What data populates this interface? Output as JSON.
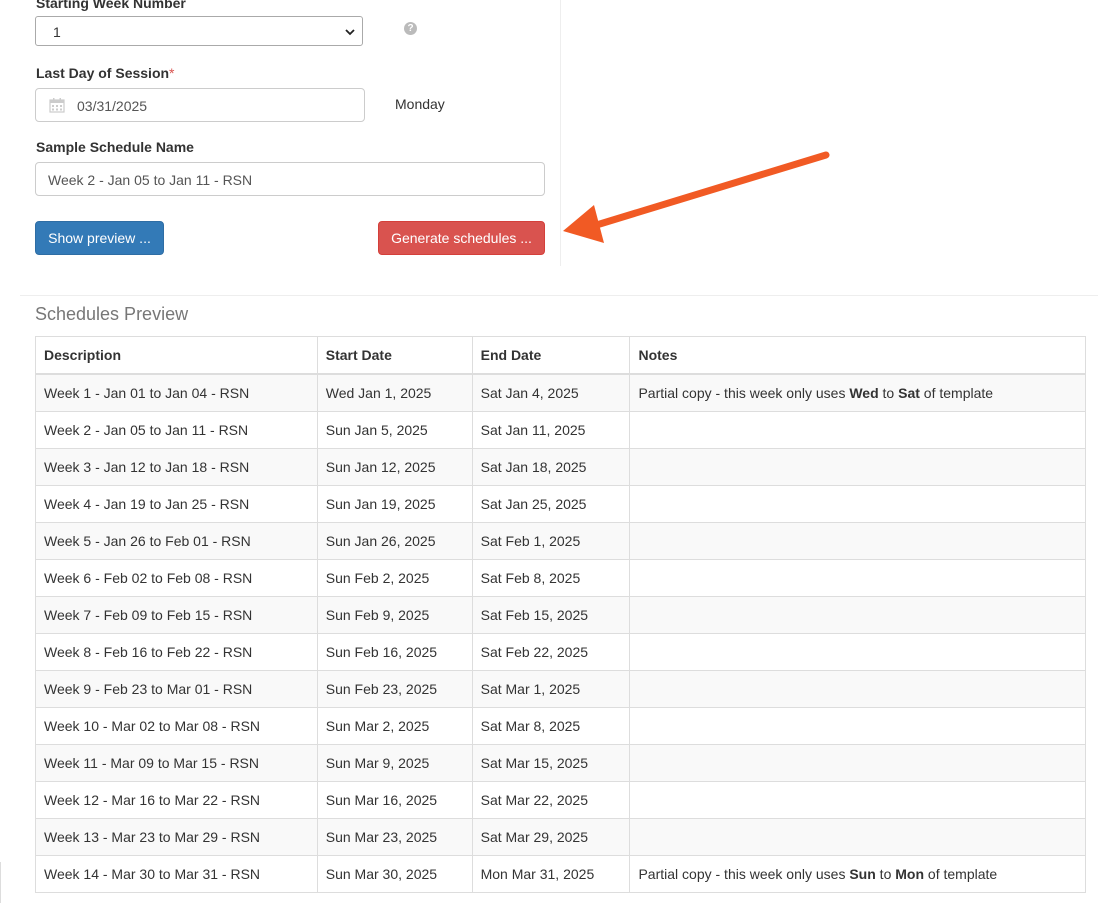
{
  "form": {
    "starting_week_label": "Starting Week Number",
    "starting_week_value": "1",
    "last_day_label": "Last Day of Session",
    "required_marker": "*",
    "last_day_value": "03/31/2025",
    "last_day_weekday": "Monday",
    "sample_name_label": "Sample Schedule Name",
    "sample_name_value": "Week 2 - Jan 05 to Jan 11 - RSN",
    "show_preview_label": "Show preview ...",
    "generate_label": "Generate schedules ..."
  },
  "preview": {
    "title": "Schedules Preview",
    "columns": [
      "Description",
      "Start Date",
      "End Date",
      "Notes"
    ],
    "rows": [
      {
        "description": "Week 1 - Jan 01 to Jan 04 - RSN",
        "start": "Wed Jan 1, 2025",
        "end": "Sat Jan 4, 2025",
        "note_pre": "Partial copy - this week only uses ",
        "note_from": "Wed",
        "note_mid": " to ",
        "note_to": "Sat",
        "note_post": " of template"
      },
      {
        "description": "Week 2 - Jan 05 to Jan 11 - RSN",
        "start": "Sun Jan 5, 2025",
        "end": "Sat Jan 11, 2025"
      },
      {
        "description": "Week 3 - Jan 12 to Jan 18 - RSN",
        "start": "Sun Jan 12, 2025",
        "end": "Sat Jan 18, 2025"
      },
      {
        "description": "Week 4 - Jan 19 to Jan 25 - RSN",
        "start": "Sun Jan 19, 2025",
        "end": "Sat Jan 25, 2025"
      },
      {
        "description": "Week 5 - Jan 26 to Feb 01 - RSN",
        "start": "Sun Jan 26, 2025",
        "end": "Sat Feb 1, 2025"
      },
      {
        "description": "Week 6 - Feb 02 to Feb 08 - RSN",
        "start": "Sun Feb 2, 2025",
        "end": "Sat Feb 8, 2025"
      },
      {
        "description": "Week 7 - Feb 09 to Feb 15 - RSN",
        "start": "Sun Feb 9, 2025",
        "end": "Sat Feb 15, 2025"
      },
      {
        "description": "Week 8 - Feb 16 to Feb 22 - RSN",
        "start": "Sun Feb 16, 2025",
        "end": "Sat Feb 22, 2025"
      },
      {
        "description": "Week 9 - Feb 23 to Mar 01 - RSN",
        "start": "Sun Feb 23, 2025",
        "end": "Sat Mar 1, 2025"
      },
      {
        "description": "Week 10 - Mar 02 to Mar 08 - RSN",
        "start": "Sun Mar 2, 2025",
        "end": "Sat Mar 8, 2025"
      },
      {
        "description": "Week 11 - Mar 09 to Mar 15 - RSN",
        "start": "Sun Mar 9, 2025",
        "end": "Sat Mar 15, 2025"
      },
      {
        "description": "Week 12 - Mar 16 to Mar 22 - RSN",
        "start": "Sun Mar 16, 2025",
        "end": "Sat Mar 22, 2025"
      },
      {
        "description": "Week 13 - Mar 23 to Mar 29 - RSN",
        "start": "Sun Mar 23, 2025",
        "end": "Sat Mar 29, 2025"
      },
      {
        "description": "Week 14 - Mar 30 to Mar 31 - RSN",
        "start": "Sun Mar 30, 2025",
        "end": "Mon Mar 31, 2025",
        "note_pre": "Partial copy - this week only uses ",
        "note_from": "Sun",
        "note_mid": " to ",
        "note_to": "Mon",
        "note_post": " of template"
      }
    ]
  },
  "icons": {
    "help": "question-circle-icon",
    "calendar": "calendar-icon",
    "dropdown": "chevron-down-icon"
  },
  "colors": {
    "primary": "#337ab7",
    "danger": "#d9534f",
    "annotation_arrow": "#f15a24",
    "required": "#d9534f"
  }
}
